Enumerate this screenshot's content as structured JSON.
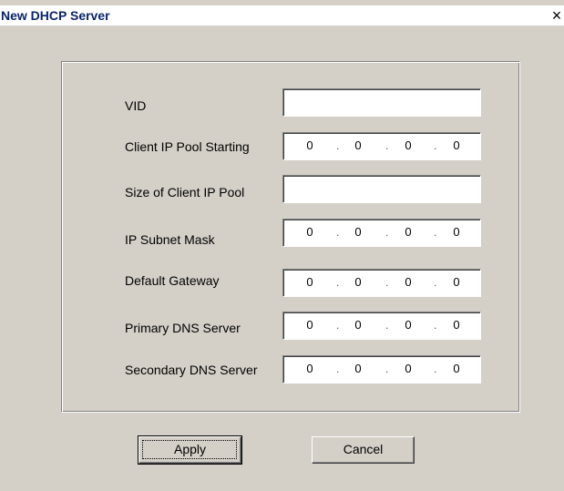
{
  "window": {
    "title": "New DHCP Server",
    "close_glyph": "×"
  },
  "form": {
    "vid": {
      "label": "VID",
      "value": ""
    },
    "client_ip_pool_starting": {
      "label": "Client IP Pool Starting",
      "octets": [
        "0",
        "0",
        "0",
        "0"
      ]
    },
    "size_of_client_ip_pool": {
      "label": "Size of Client IP Pool",
      "value": ""
    },
    "ip_subnet_mask": {
      "label": "IP Subnet Mask",
      "octets": [
        "0",
        "0",
        "0",
        "0"
      ]
    },
    "default_gateway": {
      "label": "Default Gateway",
      "octets": [
        "0",
        "0",
        "0",
        "0"
      ]
    },
    "primary_dns_server": {
      "label": "Primary DNS Server",
      "octets": [
        "0",
        "0",
        "0",
        "0"
      ]
    },
    "secondary_dns_server": {
      "label": "Secondary DNS Server",
      "octets": [
        "0",
        "0",
        "0",
        "0"
      ]
    }
  },
  "buttons": {
    "apply": "Apply",
    "cancel": "Cancel"
  },
  "colors": {
    "title_text": "#0a246a",
    "dialog_bg": "#d4d0c8"
  }
}
